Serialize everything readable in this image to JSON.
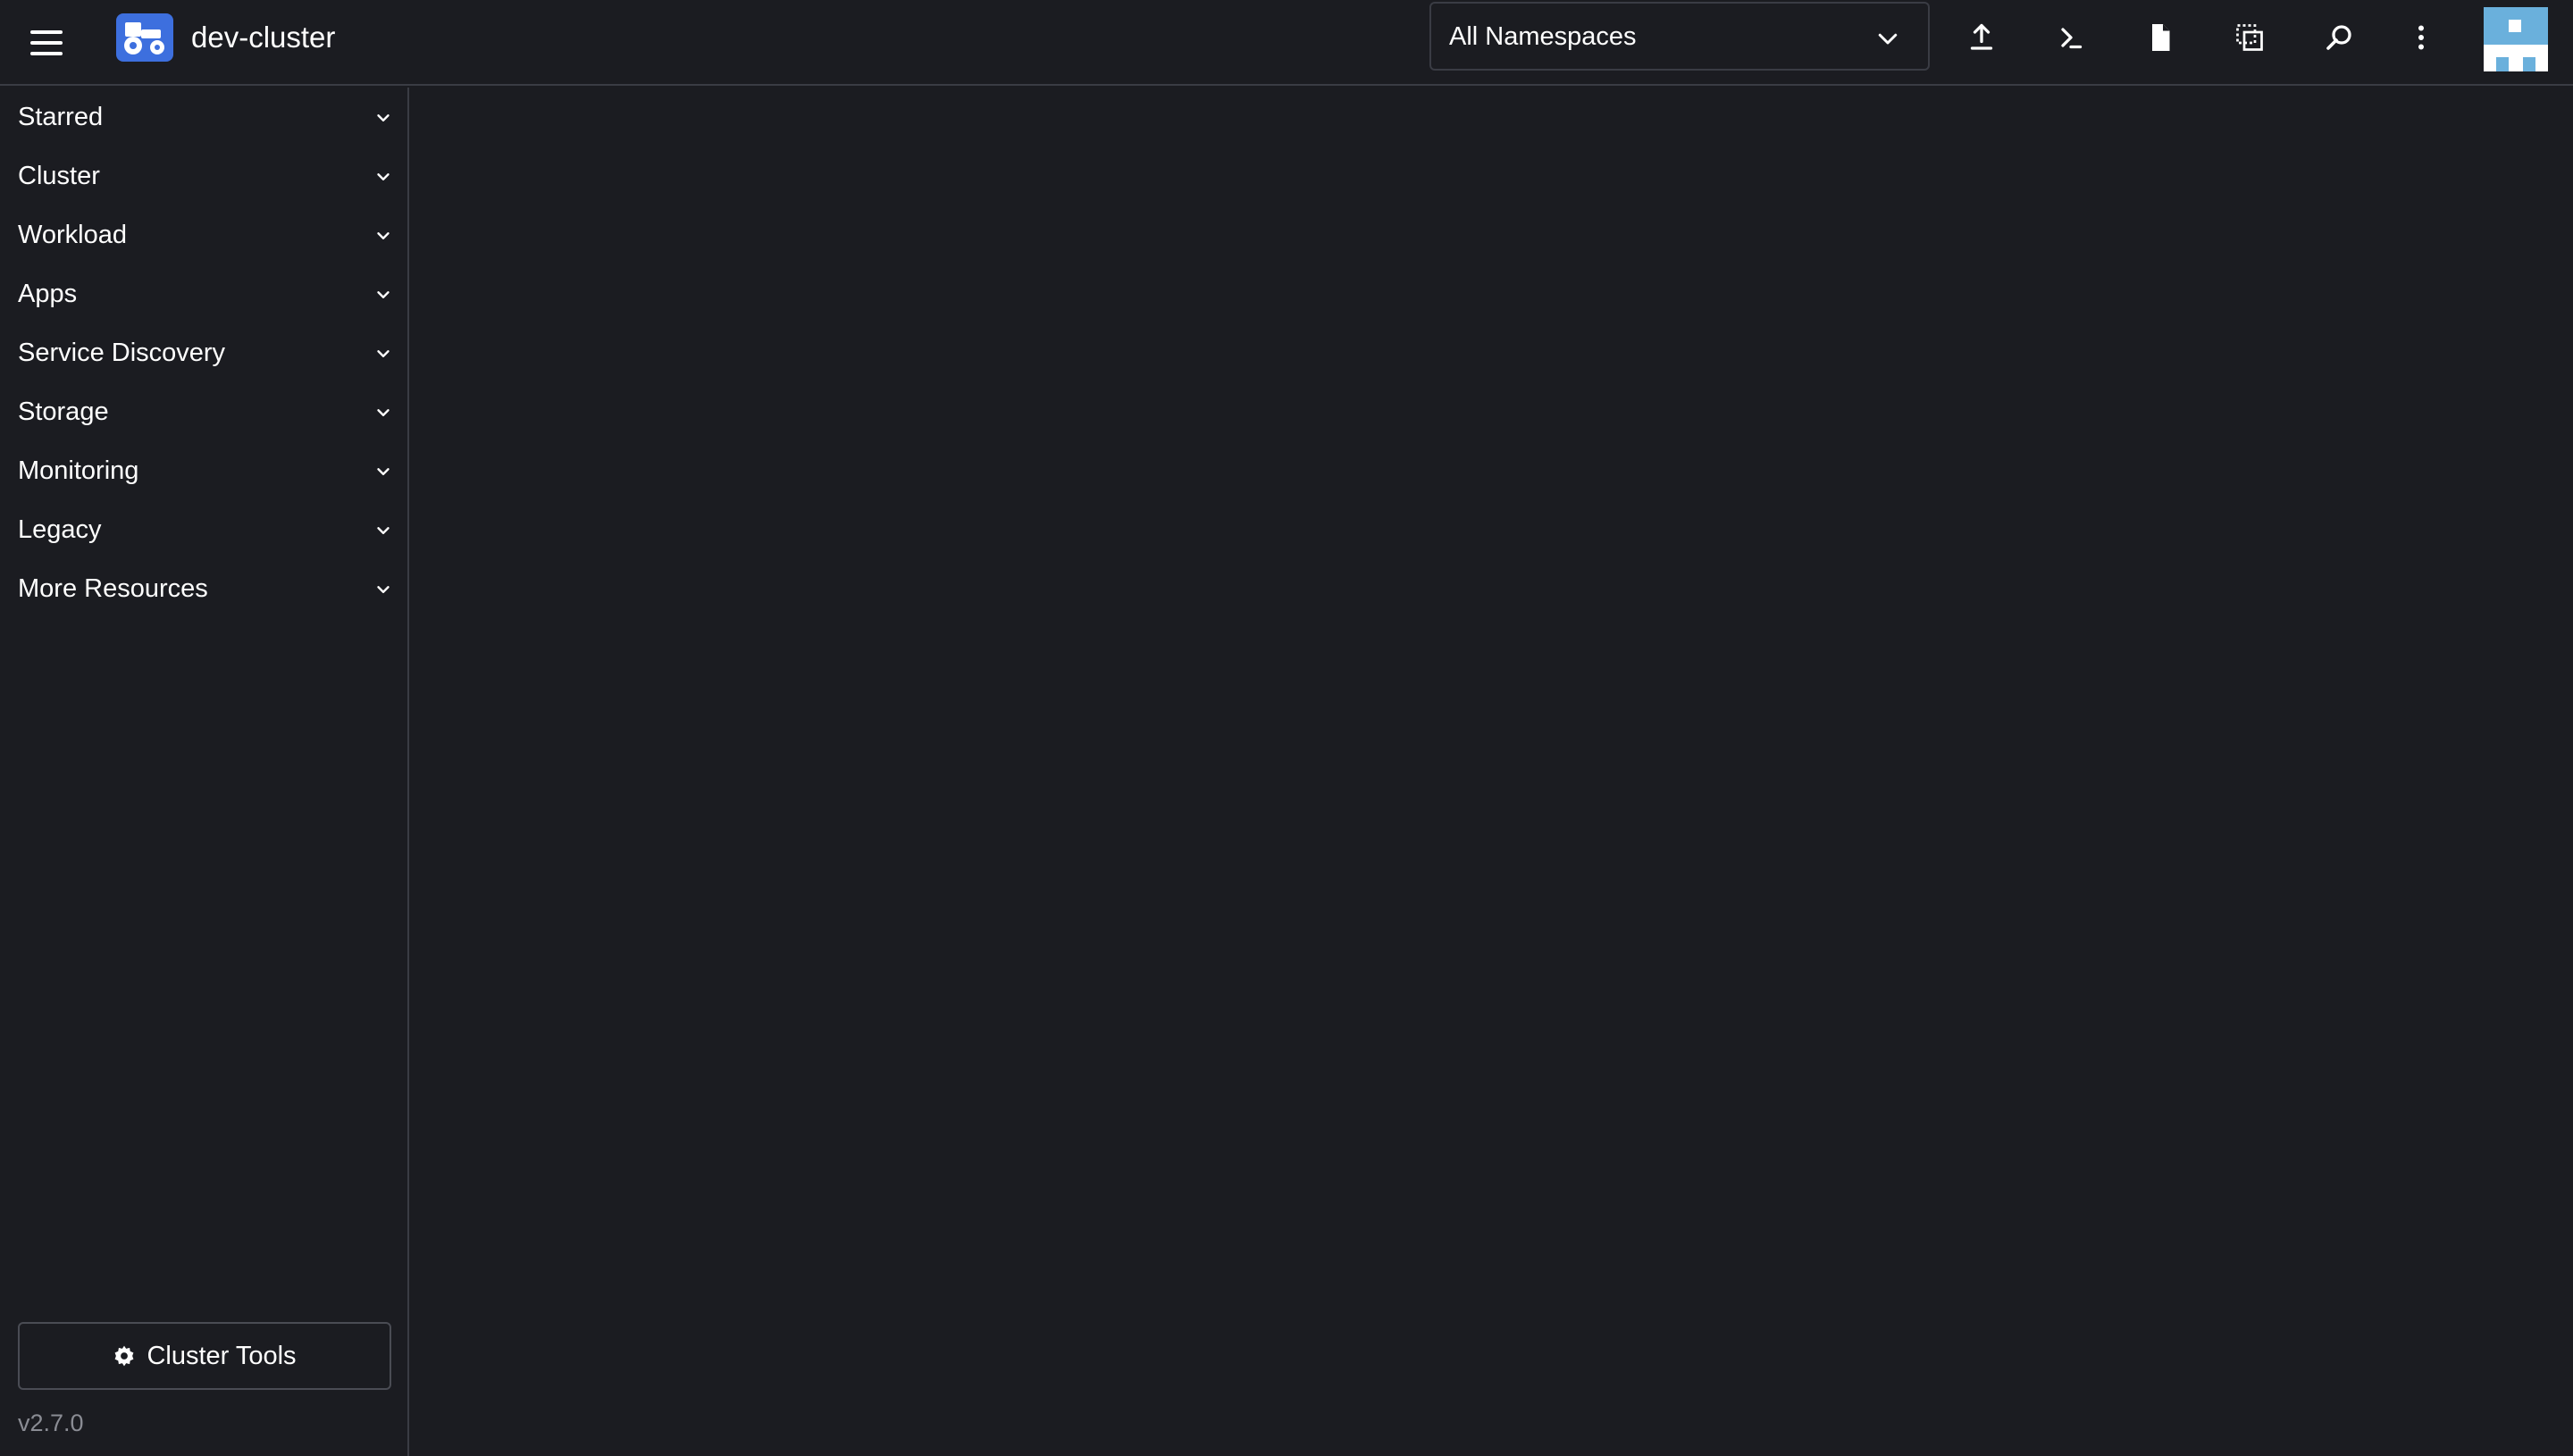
{
  "header": {
    "cluster_name": "dev-cluster",
    "namespace_select": {
      "selected": "All Namespaces"
    },
    "actions": [
      {
        "name": "import-yaml-button",
        "icon": "upload-icon"
      },
      {
        "name": "kubectl-shell-button",
        "icon": "terminal-icon"
      },
      {
        "name": "kubeconfig-download-button",
        "icon": "file-icon"
      },
      {
        "name": "copy-kubeconfig-button",
        "icon": "copy-icon"
      },
      {
        "name": "resource-search-button",
        "icon": "search-icon"
      },
      {
        "name": "more-actions-button",
        "icon": "vertical-dots-icon"
      }
    ]
  },
  "sidebar": {
    "items": [
      {
        "label": "Starred"
      },
      {
        "label": "Cluster"
      },
      {
        "label": "Workload"
      },
      {
        "label": "Apps"
      },
      {
        "label": "Service Discovery"
      },
      {
        "label": "Storage"
      },
      {
        "label": "Monitoring"
      },
      {
        "label": "Legacy"
      },
      {
        "label": "More Resources"
      }
    ],
    "cluster_tools_label": "Cluster Tools",
    "version": "v2.7.0"
  },
  "colors": {
    "background": "#1b1c21",
    "border": "#3a3c44",
    "logo_accent": "#3d6fde",
    "avatar": "#6ab0dc",
    "muted_text": "#8a8c94"
  }
}
